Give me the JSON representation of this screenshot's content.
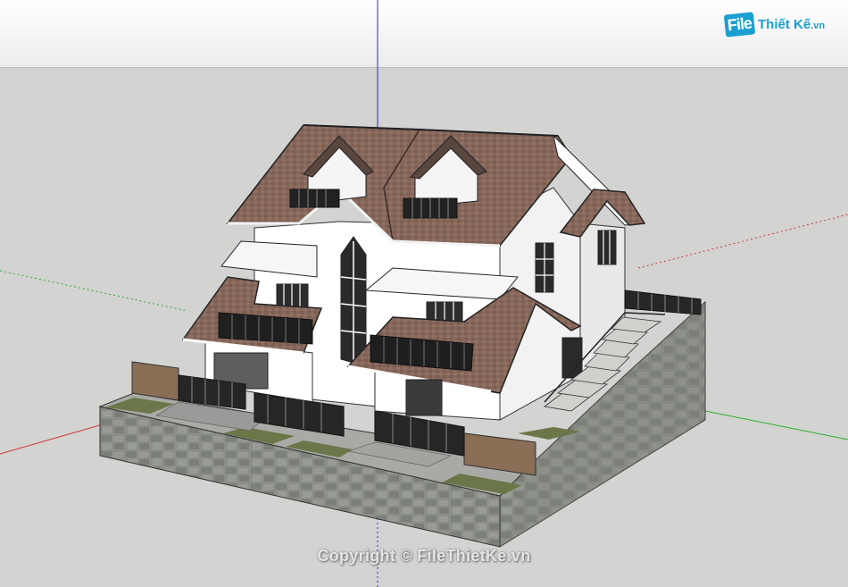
{
  "watermark": {
    "logo_mark": "File",
    "logo_text": "Thiết Kế",
    "logo_domain": ".vn",
    "copyright": "Copyright © FileThietKe.vn"
  },
  "colors": {
    "sky": "#f5f5f5",
    "ground": "#d3d3d1",
    "roof": "#8a6a5c",
    "wall": "#ffffff",
    "stone": "#8e928a",
    "grass": "#6e7a4a",
    "axis_blue": "#2a2ad6",
    "axis_red": "#d23a3a",
    "axis_green": "#2fae2f"
  },
  "scene": {
    "subject": "3D model of a two-storey villa with brown pitched roofs on a stone plinth"
  }
}
